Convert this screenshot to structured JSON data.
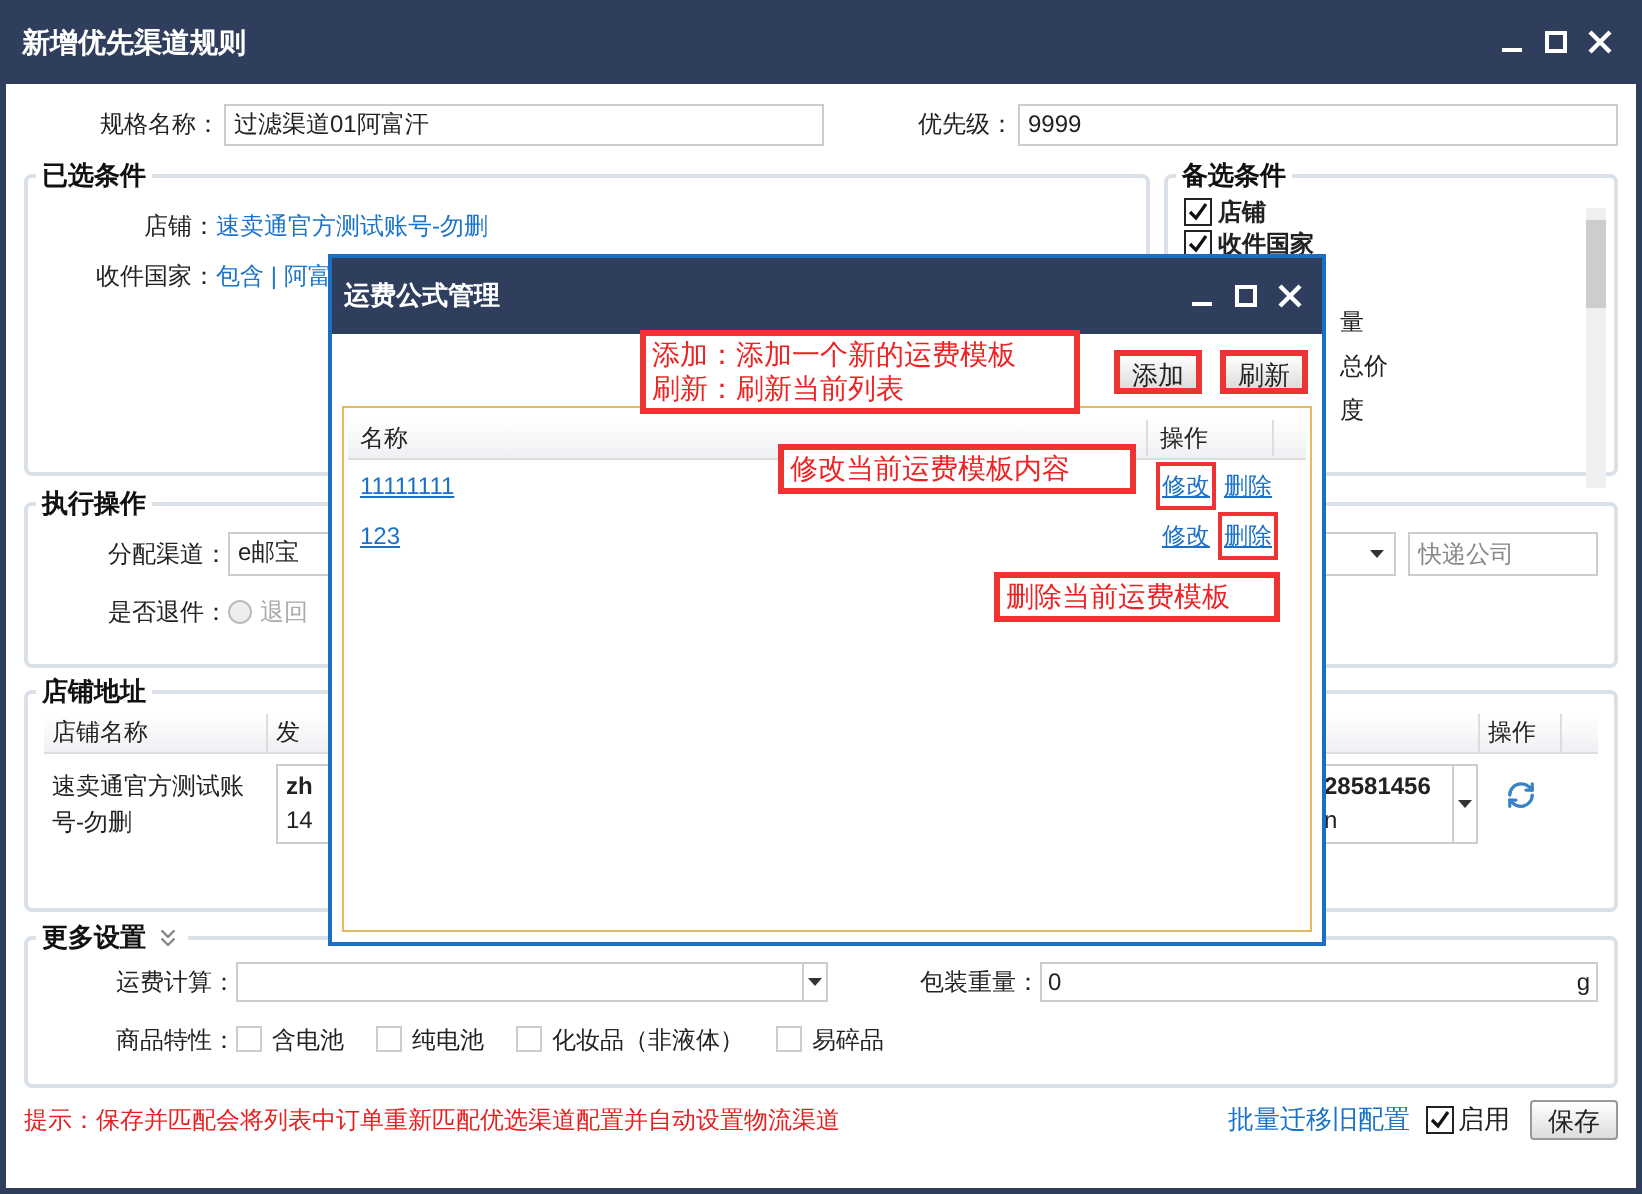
{
  "window": {
    "title": "新增优先渠道规则"
  },
  "rule_name": {
    "label": "规格名称：",
    "value": "过滤渠道01阿富汗"
  },
  "priority": {
    "label": "优先级：",
    "value": "9999"
  },
  "selected_conditions": {
    "title": "已选条件",
    "rows": [
      {
        "label": "店铺：",
        "value": "速卖通官方测试账号-勿删"
      },
      {
        "label": "收件国家：",
        "value": "包含 | 阿富"
      }
    ]
  },
  "optional_conditions": {
    "title": "备选条件",
    "items": [
      {
        "label": "店铺",
        "checked": true
      },
      {
        "label": "收件国家",
        "checked": true
      }
    ],
    "fragments": [
      "量",
      "总价",
      "度"
    ]
  },
  "execution": {
    "title": "执行操作",
    "channel": {
      "label": "分配渠道：",
      "value": "e邮宝"
    },
    "carrier": {
      "placeholder": "快递公司"
    },
    "return": {
      "label": "是否退件：",
      "option": {
        "label": "退回",
        "selected": false,
        "disabled": true
      }
    }
  },
  "store_address": {
    "title": "店铺地址",
    "columns": [
      "店铺名称",
      "发",
      "操作"
    ],
    "rows": [
      {
        "store": "速卖通官方测试账号-勿删",
        "address_start": [
          "zh",
          "14"
        ],
        "address_end": [
          "28581456",
          "n"
        ]
      }
    ]
  },
  "more_settings": {
    "title": "更多设置",
    "freight": {
      "label": "运费计算："
    },
    "weight": {
      "label": "包装重量：",
      "value": "0",
      "unit": "g"
    },
    "features": {
      "label": "商品特性：",
      "options": [
        {
          "label": "含电池",
          "checked": false
        },
        {
          "label": "纯电池",
          "checked": false
        },
        {
          "label": "化妆品（非液体）",
          "checked": false
        },
        {
          "label": "易碎品",
          "checked": false
        }
      ]
    }
  },
  "footer": {
    "hint": "提示：保存并匹配会将列表中订单重新匹配优选渠道配置并自动设置物流渠道",
    "link": "批量迁移旧配置",
    "enable": {
      "label": "启用",
      "checked": true
    },
    "save": "保存"
  },
  "modal": {
    "title": "运费公式管理",
    "buttons": [
      {
        "label": "添加",
        "highlighted": true
      },
      {
        "label": "刷新",
        "highlighted": true
      }
    ],
    "columns": [
      "名称",
      "操作"
    ],
    "rows": [
      {
        "name": "11111111",
        "actions": [
          {
            "label": "修改",
            "highlighted": true
          },
          {
            "label": "删除",
            "highlighted": false
          }
        ]
      },
      {
        "name": "123",
        "actions": [
          {
            "label": "修改",
            "highlighted": false
          },
          {
            "label": "删除",
            "highlighted": true
          }
        ]
      }
    ],
    "annotations": [
      {
        "lines": [
          "添加：添加一个新的运费模板",
          "刷新：刷新当前列表"
        ]
      },
      {
        "lines": [
          "修改当前运费模板内容"
        ]
      },
      {
        "lines": [
          "删除当前运费模板"
        ]
      }
    ]
  }
}
